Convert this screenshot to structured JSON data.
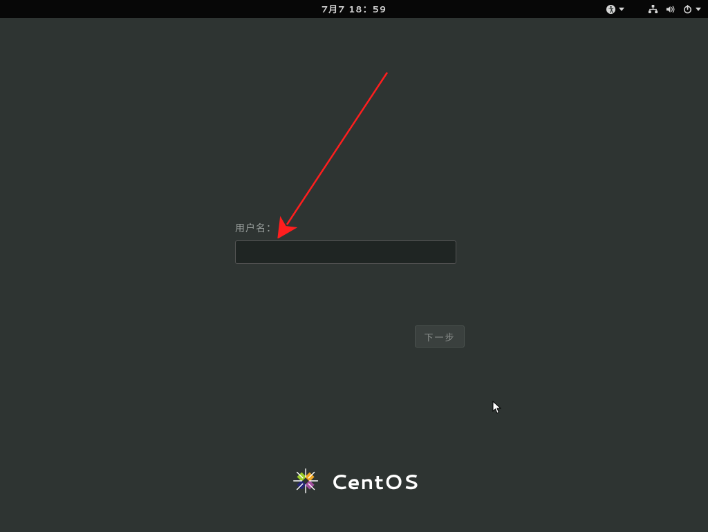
{
  "topbar": {
    "clock": "7月7 18：59"
  },
  "login": {
    "username_label": "用户名：",
    "username_value": "",
    "next_button_label": "下一步"
  },
  "branding": {
    "name": "CentOS"
  }
}
